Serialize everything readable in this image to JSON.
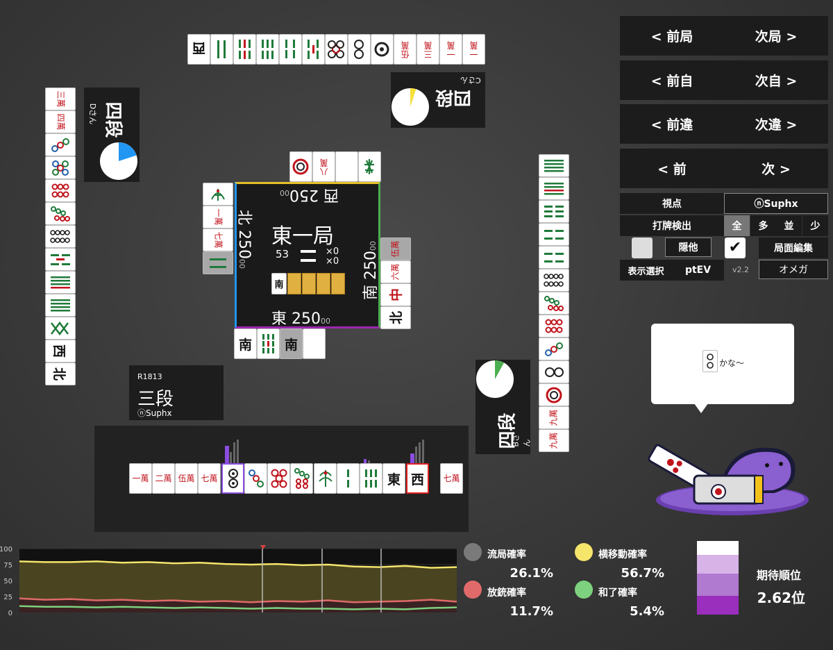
{
  "controls": {
    "prev_round": "< 前局",
    "next_round": "次局 >",
    "prev_self": "< 前自",
    "next_self": "次自 >",
    "prev_diff": "< 前違",
    "next_diff": "次違 >",
    "prev": "< 前",
    "next": "次 >",
    "viewpoint_label": "視点",
    "viewpoint_value": "ⓝSuphx",
    "discard_detect_label": "打牌検出",
    "detect_opts": [
      "全",
      "多",
      "並",
      "少"
    ],
    "hide_other": "隠他",
    "board_edit": "局面編集",
    "display_select": "表示選択",
    "ptev": "ptEV",
    "version": "v2.2",
    "omega": "オメガ"
  },
  "center": {
    "round": "東一局",
    "remaining": "53",
    "honba": "×0",
    "riichi": "×0",
    "east": "東 250",
    "east_small": "00",
    "south": "南 250",
    "south_small": "00",
    "west": "西 250",
    "west_small": "00",
    "north": "北 250",
    "north_small": "00",
    "dora_indicator": "南"
  },
  "players": {
    "self": {
      "rating": "R1813",
      "rank": "三段",
      "name": "ⓝSuphx"
    },
    "right": {
      "rank": "四段",
      "name": "Bさん",
      "pie": 0.08
    },
    "top": {
      "rank": "四段",
      "name": "Cさん",
      "pie": 0.05
    },
    "left": {
      "rank": "四段",
      "name": "Dさん",
      "pie": 0.2
    }
  },
  "speech": {
    "text": "かな～"
  },
  "hand": [
    "一萬",
    "二萬",
    "伍萬",
    "七萬",
    "2p",
    "3p",
    "5p",
    "7p",
    "1s",
    "2s",
    "6s",
    "東",
    "西"
  ],
  "draw": "七萬",
  "chart_data": {
    "type": "area",
    "ylim": [
      0,
      100
    ],
    "yticks": [
      100,
      75,
      50,
      25,
      0
    ],
    "series": [
      {
        "name": "横移動確率",
        "color": "#f5e56b",
        "values": [
          80,
          79,
          79,
          80,
          78,
          79,
          77,
          78,
          76,
          75,
          76,
          74,
          75,
          72,
          71,
          73,
          70,
          71
        ]
      },
      {
        "name": "放銃確率",
        "color": "#e06a6a",
        "values": [
          22,
          20,
          21,
          19,
          20,
          18,
          19,
          17,
          18,
          16,
          18,
          17,
          19,
          16,
          17,
          18,
          20,
          17
        ]
      },
      {
        "name": "和了確率",
        "color": "#7ed17e",
        "values": [
          10,
          9,
          9,
          8,
          9,
          8,
          7,
          8,
          7,
          6,
          7,
          6,
          6,
          5,
          6,
          5,
          7,
          8
        ]
      }
    ]
  },
  "stats": {
    "ryukyoku_label": "流局確率",
    "ryukyoku": "26.1%",
    "yoko_label": "横移動確率",
    "yoko": "56.7%",
    "houju_label": "放銃確率",
    "houju": "11.7%",
    "hora_label": "和了確率",
    "hora": "5.4%",
    "expected_label": "期待順位",
    "expected": "2.62位"
  },
  "colors": {
    "ryukyoku": "#7a7a7a",
    "yoko": "#f5e56b",
    "houju": "#e06a6a",
    "hora": "#7ed17e"
  }
}
